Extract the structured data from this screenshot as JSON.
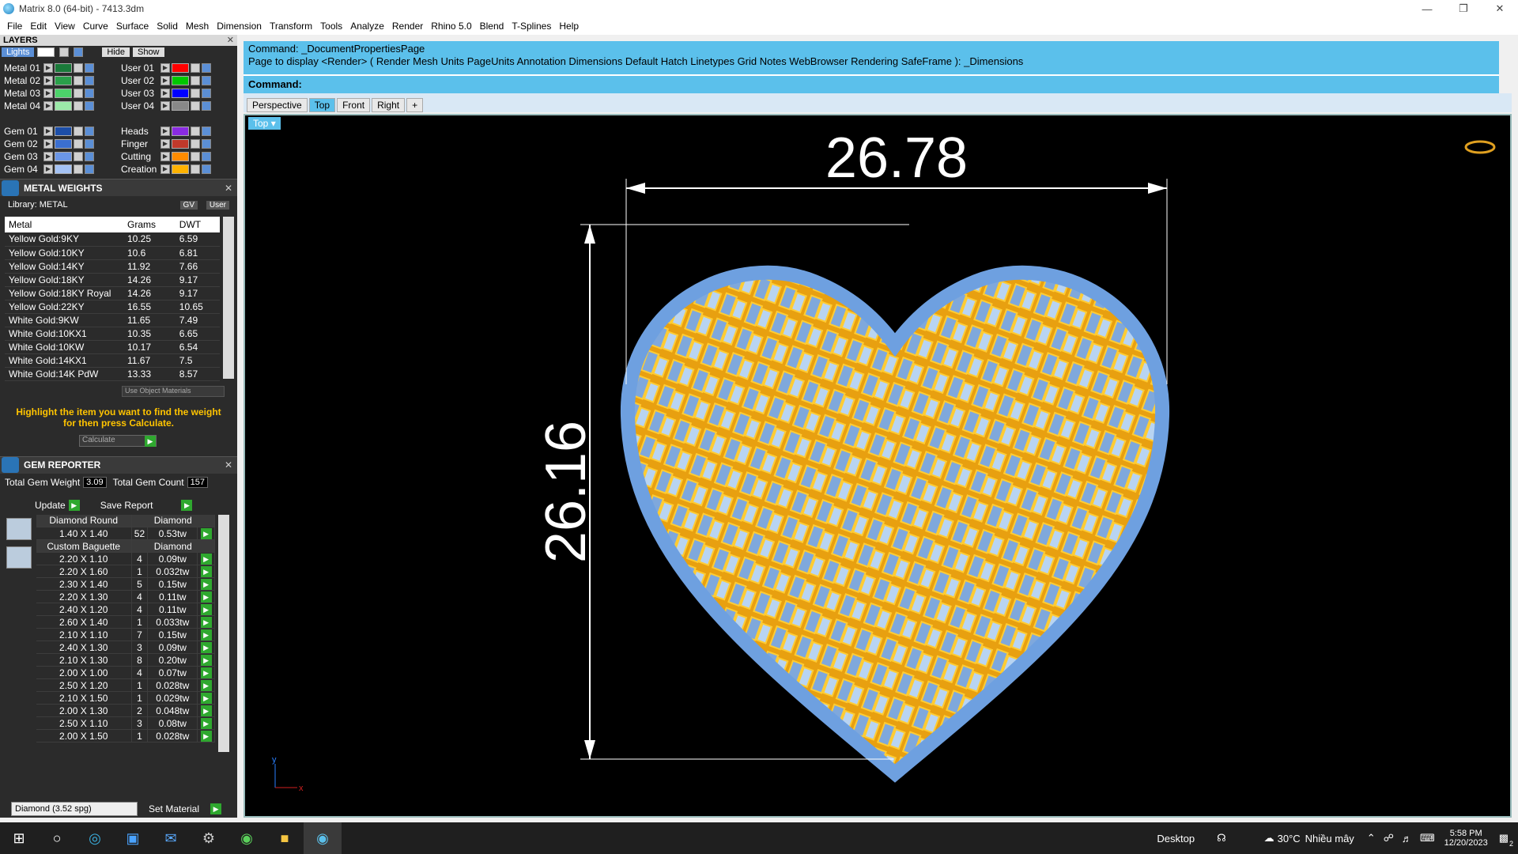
{
  "window": {
    "title": "Matrix 8.0 (64-bit) - 7413.3dm"
  },
  "menu": [
    "File",
    "Edit",
    "View",
    "Curve",
    "Surface",
    "Solid",
    "Mesh",
    "Dimension",
    "Transform",
    "Tools",
    "Analyze",
    "Render",
    "Rhino 5.0",
    "Blend",
    "T-Splines",
    "Help"
  ],
  "layers": {
    "title": "LAYERS",
    "lights": "Lights",
    "hide": "Hide",
    "show": "Show",
    "left": [
      {
        "name": "Metal 01",
        "color": "#1a7a3a"
      },
      {
        "name": "Metal 02",
        "color": "#2aa04a"
      },
      {
        "name": "Metal 03",
        "color": "#4cd36a"
      },
      {
        "name": "Metal 04",
        "color": "#9be8a8"
      },
      {
        "name": "Gem 01",
        "color": "#1c4ea8"
      },
      {
        "name": "Gem 02",
        "color": "#3b6fd0"
      },
      {
        "name": "Gem 03",
        "color": "#6b96e6"
      },
      {
        "name": "Gem 04",
        "color": "#a4c2f4"
      }
    ],
    "right": [
      {
        "name": "User 01",
        "color": "#ff0000"
      },
      {
        "name": "User 02",
        "color": "#00c800"
      },
      {
        "name": "User 03",
        "color": "#0000ff"
      },
      {
        "name": "User 04",
        "color": "#888888"
      },
      {
        "name": "Heads",
        "color": "#8a2be2"
      },
      {
        "name": "Finger",
        "color": "#c0392b"
      },
      {
        "name": "Cutting",
        "color": "#ff8c00"
      },
      {
        "name": "Creation",
        "color": "#ffb300"
      }
    ]
  },
  "metal_weights": {
    "title": "METAL WEIGHTS",
    "library": "Library: METAL",
    "gv": "GV",
    "user": "User",
    "headers": [
      "Metal",
      "Grams",
      "DWT"
    ],
    "rows": [
      [
        "Yellow Gold:9KY",
        "10.25",
        "6.59"
      ],
      [
        "Yellow Gold:10KY",
        "10.6",
        "6.81"
      ],
      [
        "Yellow Gold:14KY",
        "11.92",
        "7.66"
      ],
      [
        "Yellow Gold:18KY",
        "14.26",
        "9.17"
      ],
      [
        "Yellow Gold:18KY Royal",
        "14.26",
        "9.17"
      ],
      [
        "Yellow Gold:22KY",
        "16.55",
        "10.65"
      ],
      [
        "White Gold:9KW",
        "11.65",
        "7.49"
      ],
      [
        "White Gold:10KX1",
        "10.35",
        "6.65"
      ],
      [
        "White Gold:10KW",
        "10.17",
        "6.54"
      ],
      [
        "White Gold:14KX1",
        "11.67",
        "7.5"
      ],
      [
        "White Gold:14K PdW",
        "13.33",
        "8.57"
      ]
    ],
    "use_object": "Use Object Materials",
    "hint": "Highlight the item you want to find the weight for then press Calculate.",
    "calculate": "Calculate"
  },
  "gem_reporter": {
    "title": "GEM REPORTER",
    "total_weight_label": "Total Gem Weight",
    "total_weight": "3.09",
    "total_count_label": "Total Gem Count",
    "total_count": "157",
    "update": "Update",
    "save": "Save Report",
    "round": {
      "name": "Diamond Round",
      "type": "Diamond",
      "rows": [
        [
          "1.40 X 1.40",
          "52",
          "0.53tw"
        ]
      ]
    },
    "baguette": {
      "name": "Custom Baguette",
      "type": "Diamond",
      "rows": [
        [
          "2.20 X 1.10",
          "4",
          "0.09tw"
        ],
        [
          "2.20 X 1.60",
          "1",
          "0.032tw"
        ],
        [
          "2.30 X 1.40",
          "5",
          "0.15tw"
        ],
        [
          "2.20 X 1.30",
          "4",
          "0.11tw"
        ],
        [
          "2.40 X 1.20",
          "4",
          "0.11tw"
        ],
        [
          "2.60 X 1.40",
          "1",
          "0.033tw"
        ],
        [
          "2.10 X 1.10",
          "7",
          "0.15tw"
        ],
        [
          "2.40 X 1.30",
          "3",
          "0.09tw"
        ],
        [
          "2.10 X 1.30",
          "8",
          "0.20tw"
        ],
        [
          "2.00 X 1.00",
          "4",
          "0.07tw"
        ],
        [
          "2.50 X 1.20",
          "1",
          "0.028tw"
        ],
        [
          "2.10 X 1.50",
          "1",
          "0.029tw"
        ],
        [
          "2.00 X 1.30",
          "2",
          "0.048tw"
        ],
        [
          "2.50 X 1.10",
          "3",
          "0.08tw"
        ],
        [
          "2.00 X 1.50",
          "1",
          "0.028tw"
        ]
      ]
    },
    "material": "Diamond   (3.52 spg)",
    "set_material": "Set Material"
  },
  "command": {
    "line1": "Command: _DocumentPropertiesPage",
    "line2": "Page to display <Render> ( Render  Mesh  Units  PageUnits  Annotation  Dimensions  Default  Hatch  Linetypes  Grid  Notes  WebBrowser  Rendering  SafeFrame ): _Dimensions",
    "prompt": "Command:"
  },
  "viewport_tabs": [
    "Perspective",
    "Top",
    "Front",
    "Right"
  ],
  "viewport_label": "Top",
  "dimensions": {
    "width": "26.78",
    "height": "26.16"
  },
  "axes": {
    "y": "y",
    "x": "x"
  },
  "taskbar": {
    "desktop": "Desktop",
    "temp": "30°C",
    "weather": "Nhiều mây",
    "time": "5:58 PM",
    "date": "12/20/2023",
    "notif": "2"
  }
}
